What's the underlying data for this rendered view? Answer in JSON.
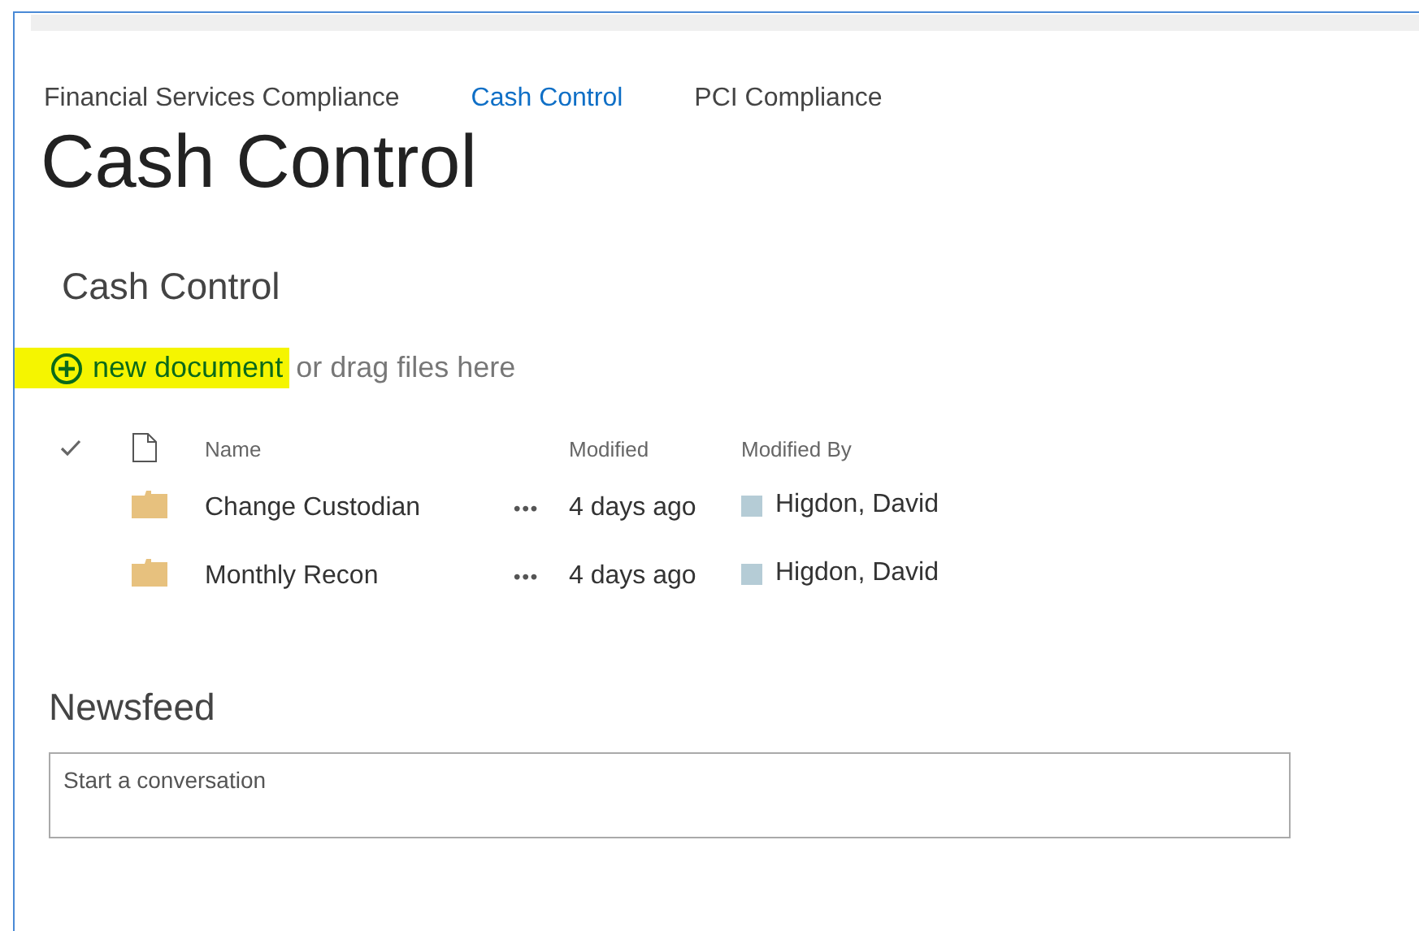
{
  "top_nav": [
    {
      "label": "Financial Services Compliance",
      "selected": false
    },
    {
      "label": "Cash Control",
      "selected": true
    },
    {
      "label": "PCI Compliance",
      "selected": false
    }
  ],
  "page_title": "Cash Control",
  "library": {
    "title": "Cash Control",
    "new_document": {
      "label": "new document",
      "highlighted": true
    },
    "drag_hint": "or drag files here",
    "columns": [
      "Name",
      "Modified",
      "Modified By"
    ],
    "rows": [
      {
        "name": "Change Custodian",
        "menu": "•••",
        "modified": "4 days ago",
        "modified_by": "Higdon, David"
      },
      {
        "name": "Monthly Recon",
        "menu": "•••",
        "modified": "4 days ago",
        "modified_by": "Higdon, David"
      }
    ]
  },
  "newsfeed": {
    "title": "Newsfeed",
    "placeholder": "Start a conversation"
  }
}
